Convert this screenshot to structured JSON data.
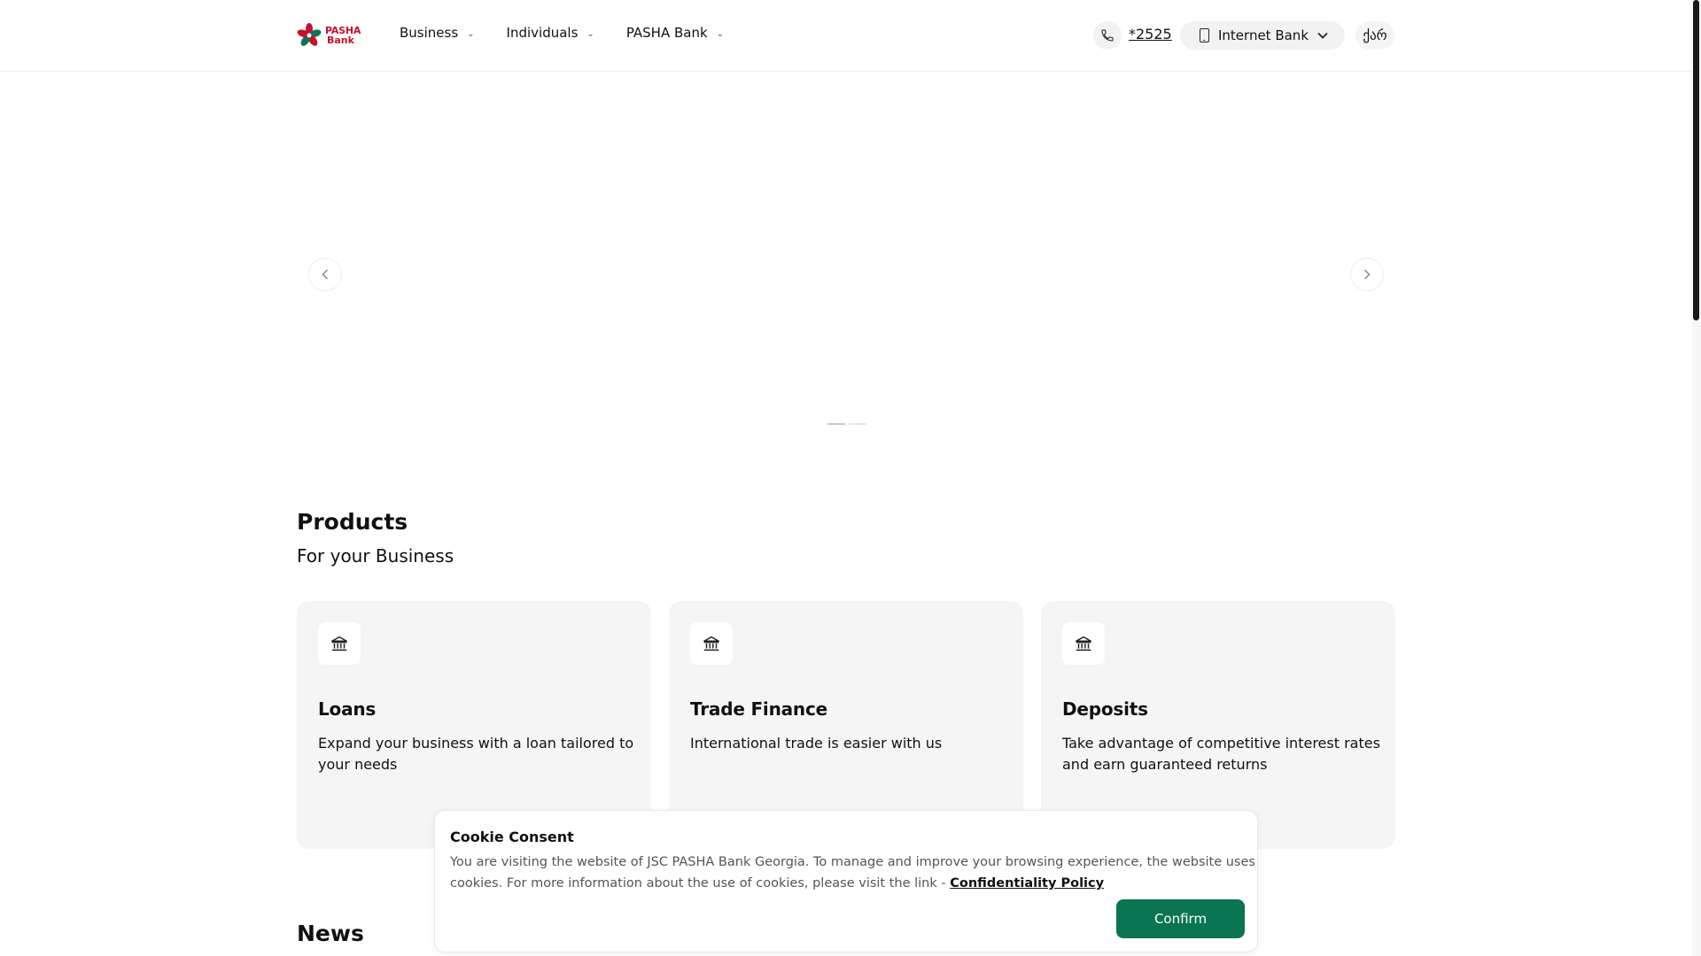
{
  "header": {
    "logo": {
      "line1": "PASHA",
      "line2": "Bank"
    },
    "nav": [
      {
        "label": "Business"
      },
      {
        "label": "Individuals"
      },
      {
        "label": "PASHA Bank"
      }
    ],
    "phone_number": "*2525",
    "internet_bank_label": "Internet Bank",
    "language_label": "ქარ"
  },
  "hero": {
    "slides_count": 2,
    "active_slide": 1
  },
  "products": {
    "title": "Products",
    "subtitle": "For your Business",
    "cards": [
      {
        "title": "Loans",
        "description": "Expand your business with a loan tailored to your needs"
      },
      {
        "title": "Trade Finance",
        "description": "International trade is easier with us"
      },
      {
        "title": "Deposits",
        "description": "Take advantage of competitive interest rates and earn guaranteed returns"
      }
    ]
  },
  "news": {
    "title": "News"
  },
  "cookie": {
    "title": "Cookie Consent",
    "text": "You are visiting the website of JSC PASHA Bank Georgia. To manage and improve your browsing experience, the website uses cookies. For more information about the use of cookies, please visit the link - ",
    "link_label": "Confidentiality Policy",
    "confirm_label": "Confirm"
  },
  "colors": {
    "brand_red": "#c8102e",
    "brand_green": "#0b7452",
    "card_bg": "#f5f5f5"
  }
}
